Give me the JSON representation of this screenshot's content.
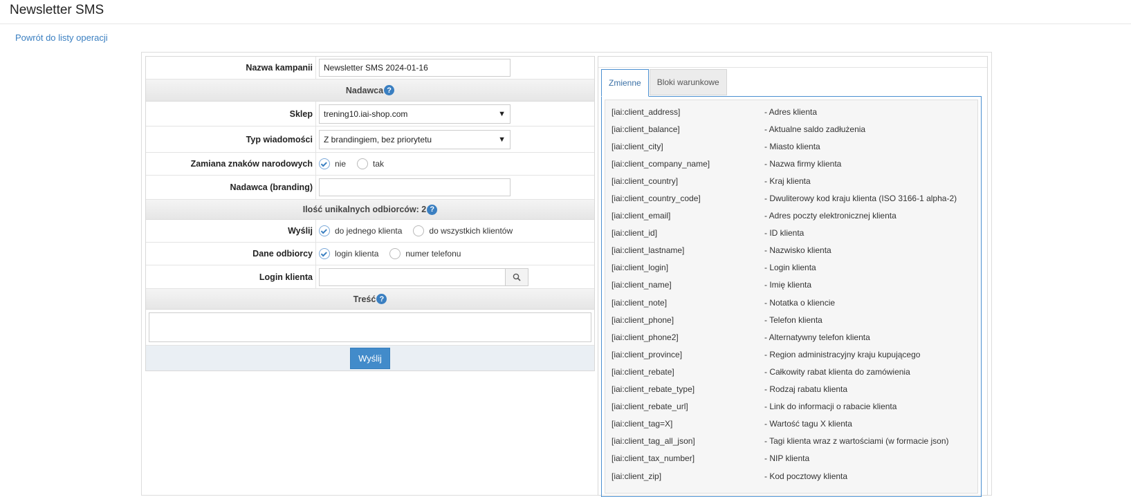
{
  "page": {
    "title": "Newsletter SMS",
    "back_link": "Powrót do listy operacji"
  },
  "form": {
    "campaign_name_label": "Nazwa kampanii",
    "campaign_name_value": "Newsletter SMS 2024-01-16",
    "sender_section": "Nadawca",
    "shop_label": "Sklep",
    "shop_value": "trening10.iai-shop.com",
    "message_type_label": "Typ wiadomości",
    "message_type_value": "Z brandingiem, bez priorytetu",
    "char_replace_label": "Zamiana znaków narodowych",
    "char_replace_options": [
      "nie",
      "tak"
    ],
    "char_replace_selected": "nie",
    "branding_label": "Nadawca (branding)",
    "branding_value": "",
    "recipients_section": "Ilość unikalnych odbiorców: 2",
    "send_label": "Wyślij",
    "send_options": [
      "do jednego klienta",
      "do wszystkich klientów"
    ],
    "send_selected": "do jednego klienta",
    "recipient_data_label": "Dane odbiorcy",
    "recipient_data_options": [
      "login klienta",
      "numer telefonu"
    ],
    "recipient_data_selected": "login klienta",
    "client_login_label": "Login klienta",
    "client_login_value": "",
    "content_section": "Treść",
    "content_value": "",
    "submit_label": "Wyślij"
  },
  "icons": {
    "help": "question-circle-icon",
    "search": "search-icon",
    "dropdown": "chevron-down-icon"
  },
  "colors": {
    "accent": "#428bca",
    "link": "#3a7fc1"
  },
  "right": {
    "tabs": [
      {
        "label": "Zmienne",
        "active": true
      },
      {
        "label": "Bloki warunkowe",
        "active": false
      }
    ],
    "variables": [
      {
        "key": "[iai:client_address]",
        "desc": "- Adres klienta"
      },
      {
        "key": "[iai:client_balance]",
        "desc": "- Aktualne saldo zadłużenia"
      },
      {
        "key": "[iai:client_city]",
        "desc": "- Miasto klienta"
      },
      {
        "key": "[iai:client_company_name]",
        "desc": "- Nazwa firmy klienta"
      },
      {
        "key": "[iai:client_country]",
        "desc": "- Kraj klienta"
      },
      {
        "key": "[iai:client_country_code]",
        "desc": "- Dwuliterowy kod kraju klienta (ISO 3166-1 alpha-2)"
      },
      {
        "key": "[iai:client_email]",
        "desc": "- Adres poczty elektronicznej klienta"
      },
      {
        "key": "[iai:client_id]",
        "desc": "- ID klienta"
      },
      {
        "key": "[iai:client_lastname]",
        "desc": "- Nazwisko klienta"
      },
      {
        "key": "[iai:client_login]",
        "desc": "- Login klienta"
      },
      {
        "key": "[iai:client_name]",
        "desc": "- Imię klienta"
      },
      {
        "key": "[iai:client_note]",
        "desc": "- Notatka o kliencie"
      },
      {
        "key": "[iai:client_phone]",
        "desc": "- Telefon klienta"
      },
      {
        "key": "[iai:client_phone2]",
        "desc": "- Alternatywny telefon klienta"
      },
      {
        "key": "[iai:client_province]",
        "desc": "- Region administracyjny kraju kupującego"
      },
      {
        "key": "[iai:client_rebate]",
        "desc": "- Całkowity rabat klienta do zamówienia"
      },
      {
        "key": "[iai:client_rebate_type]",
        "desc": "- Rodzaj rabatu klienta"
      },
      {
        "key": "[iai:client_rebate_url]",
        "desc": "- Link do informacji o rabacie klienta"
      },
      {
        "key": "[iai:client_tag=X]",
        "desc": "- Wartość tagu X klienta"
      },
      {
        "key": "[iai:client_tag_all_json]",
        "desc": "- Tagi klienta wraz z wartościami (w formacie json)"
      },
      {
        "key": "[iai:client_tax_number]",
        "desc": "- NIP klienta"
      },
      {
        "key": "[iai:client_zip]",
        "desc": "- Kod pocztowy klienta"
      }
    ]
  }
}
